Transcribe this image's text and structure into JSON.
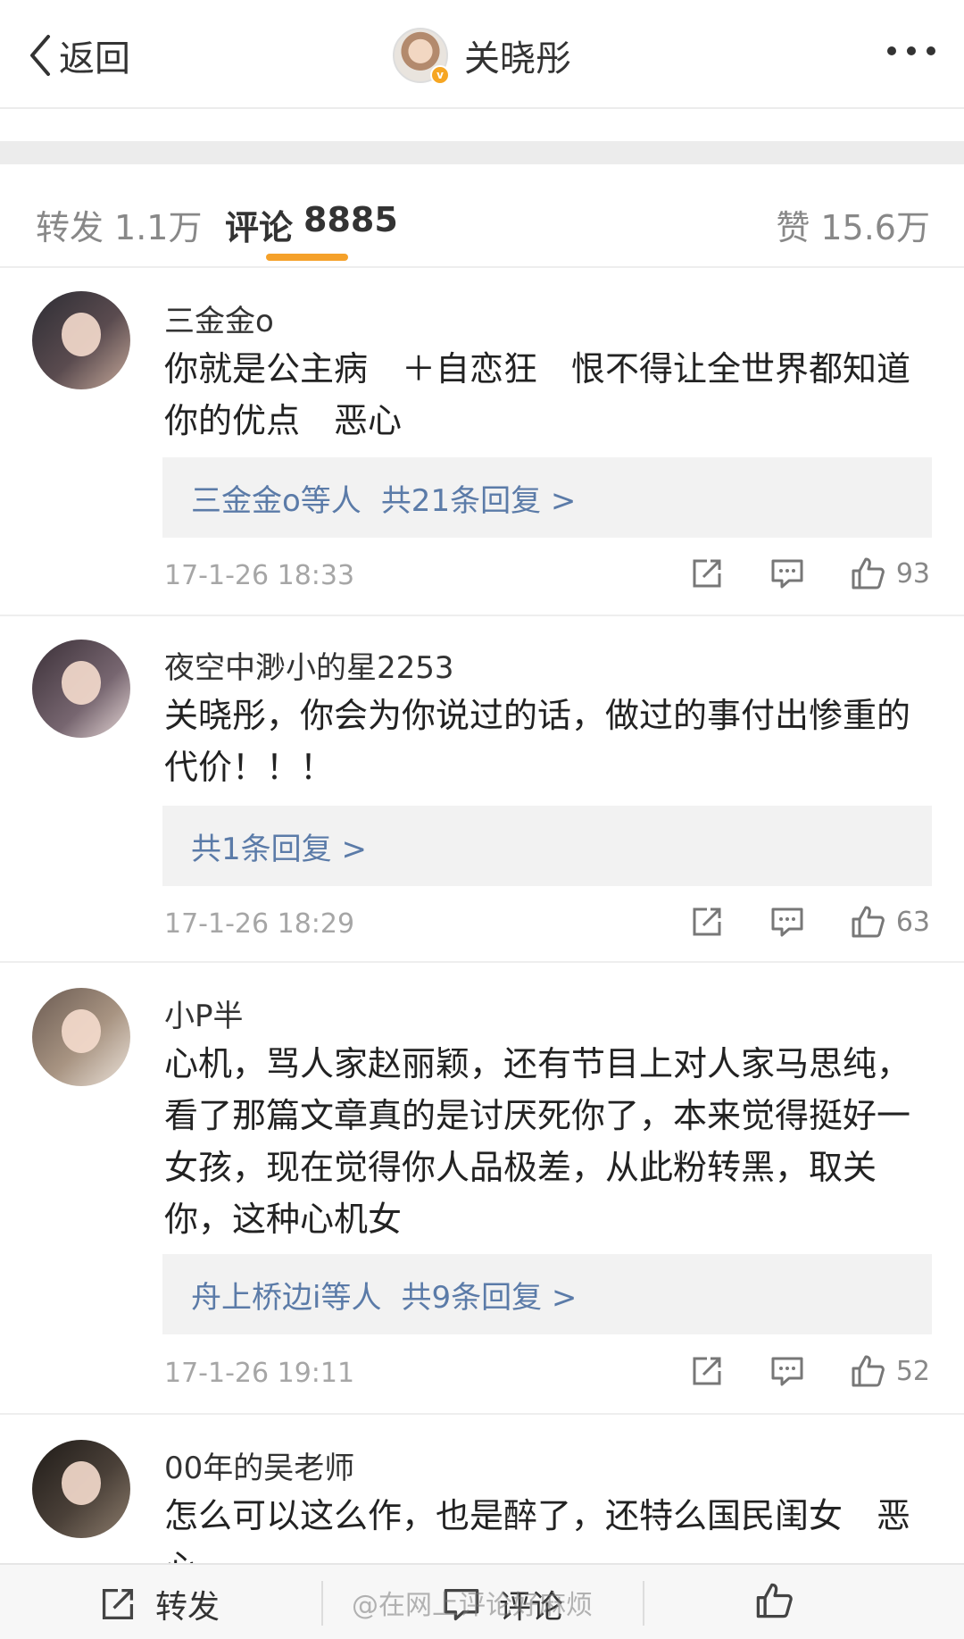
{
  "nav": {
    "back_label": "返回",
    "title": "关晓彤",
    "verified_badge": "v"
  },
  "tabs": {
    "repost_label": "转发",
    "repost_count": "1.1万",
    "comment_label": "评论",
    "comment_count": "8885",
    "like_label": "赞",
    "like_count": "15.6万"
  },
  "comments": [
    {
      "username": "三金金o",
      "text": "你就是公主病　＋自恋狂　恨不得让全世界都知道你的优点　恶心",
      "reply_prefix": "三金金o等人",
      "reply_summary": "共21条回复 >",
      "time": "17-1-26 18:33",
      "likes": "93"
    },
    {
      "username": "夜空中渺小的星2253",
      "text": "关晓彤，你会为你说过的话，做过的事付出惨重的代价！！！",
      "reply_prefix": "",
      "reply_summary": "共1条回复 >",
      "time": "17-1-26 18:29",
      "likes": "63"
    },
    {
      "username": "小P半",
      "text": "心机，骂人家赵丽颖，还有节目上对人家马思纯，看了那篇文章真的是讨厌死你了，本来觉得挺好一女孩，现在觉得你人品极差，从此粉转黑，取关你，这种心机女",
      "reply_prefix": "舟上桥边i等人",
      "reply_summary": "共9条回复 >",
      "time": "17-1-26 19:11",
      "likes": "52"
    },
    {
      "username": "00年的吴老师",
      "text": "怎么可以这么作，也是醉了，还特么国民闺女　恶心"
    }
  ],
  "bottombar": {
    "repost_label": "转发",
    "comment_label": "评论",
    "watermark": "@在网上评论好麻烦"
  },
  "icons": {
    "back": "chevron-left-icon",
    "more": "more-dots-icon",
    "share": "share-icon",
    "reply": "comment-bubble-icon",
    "like": "thumbs-up-icon"
  },
  "colors": {
    "accent": "#f5a12a",
    "link": "#5b7ba8",
    "verified": "#f6a623"
  }
}
